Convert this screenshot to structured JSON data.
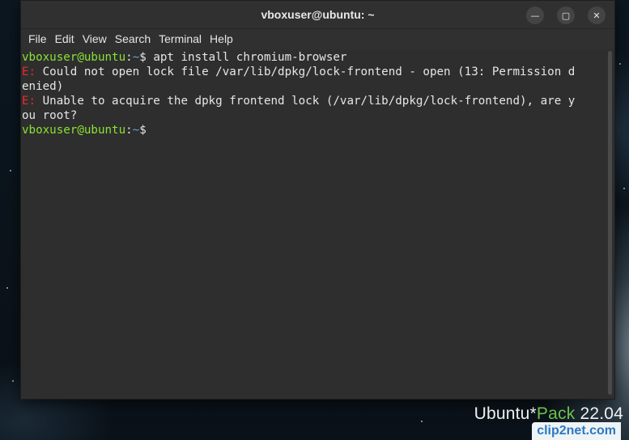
{
  "window": {
    "title": "vboxuser@ubuntu: ~",
    "minimize_glyph": "—",
    "maximize_glyph": "▢",
    "close_glyph": "✕"
  },
  "menu": [
    "File",
    "Edit",
    "View",
    "Search",
    "Terminal",
    "Help"
  ],
  "terminal": {
    "line1": {
      "user": "vboxuser@ubuntu",
      "sep": ":",
      "path": "~",
      "dollar": "$ ",
      "command": "apt install chromium-browser"
    },
    "line2": {
      "prefix": "E:",
      "text": " Could not open lock file /var/lib/dpkg/lock-frontend - open (13: Permission d"
    },
    "line3": {
      "text": "enied)"
    },
    "line4": {
      "prefix": "E:",
      "text": " Unable to acquire the dpkg frontend lock (/var/lib/dpkg/lock-frontend), are y"
    },
    "line5": {
      "text": "ou root?"
    },
    "line6": {
      "user": "vboxuser@ubuntu",
      "sep": ":",
      "path": "~",
      "dollar": "$ "
    }
  },
  "brand": {
    "name": "Ubuntu",
    "star": "*",
    "pack": "Pack",
    "version": " 22.04"
  },
  "watermark": "clip2net.com",
  "colors": {
    "prompt_user": "#8ae234",
    "prompt_path": "#729fcf",
    "error": "#ef2929",
    "terminal_bg": "#2e2e2e"
  }
}
